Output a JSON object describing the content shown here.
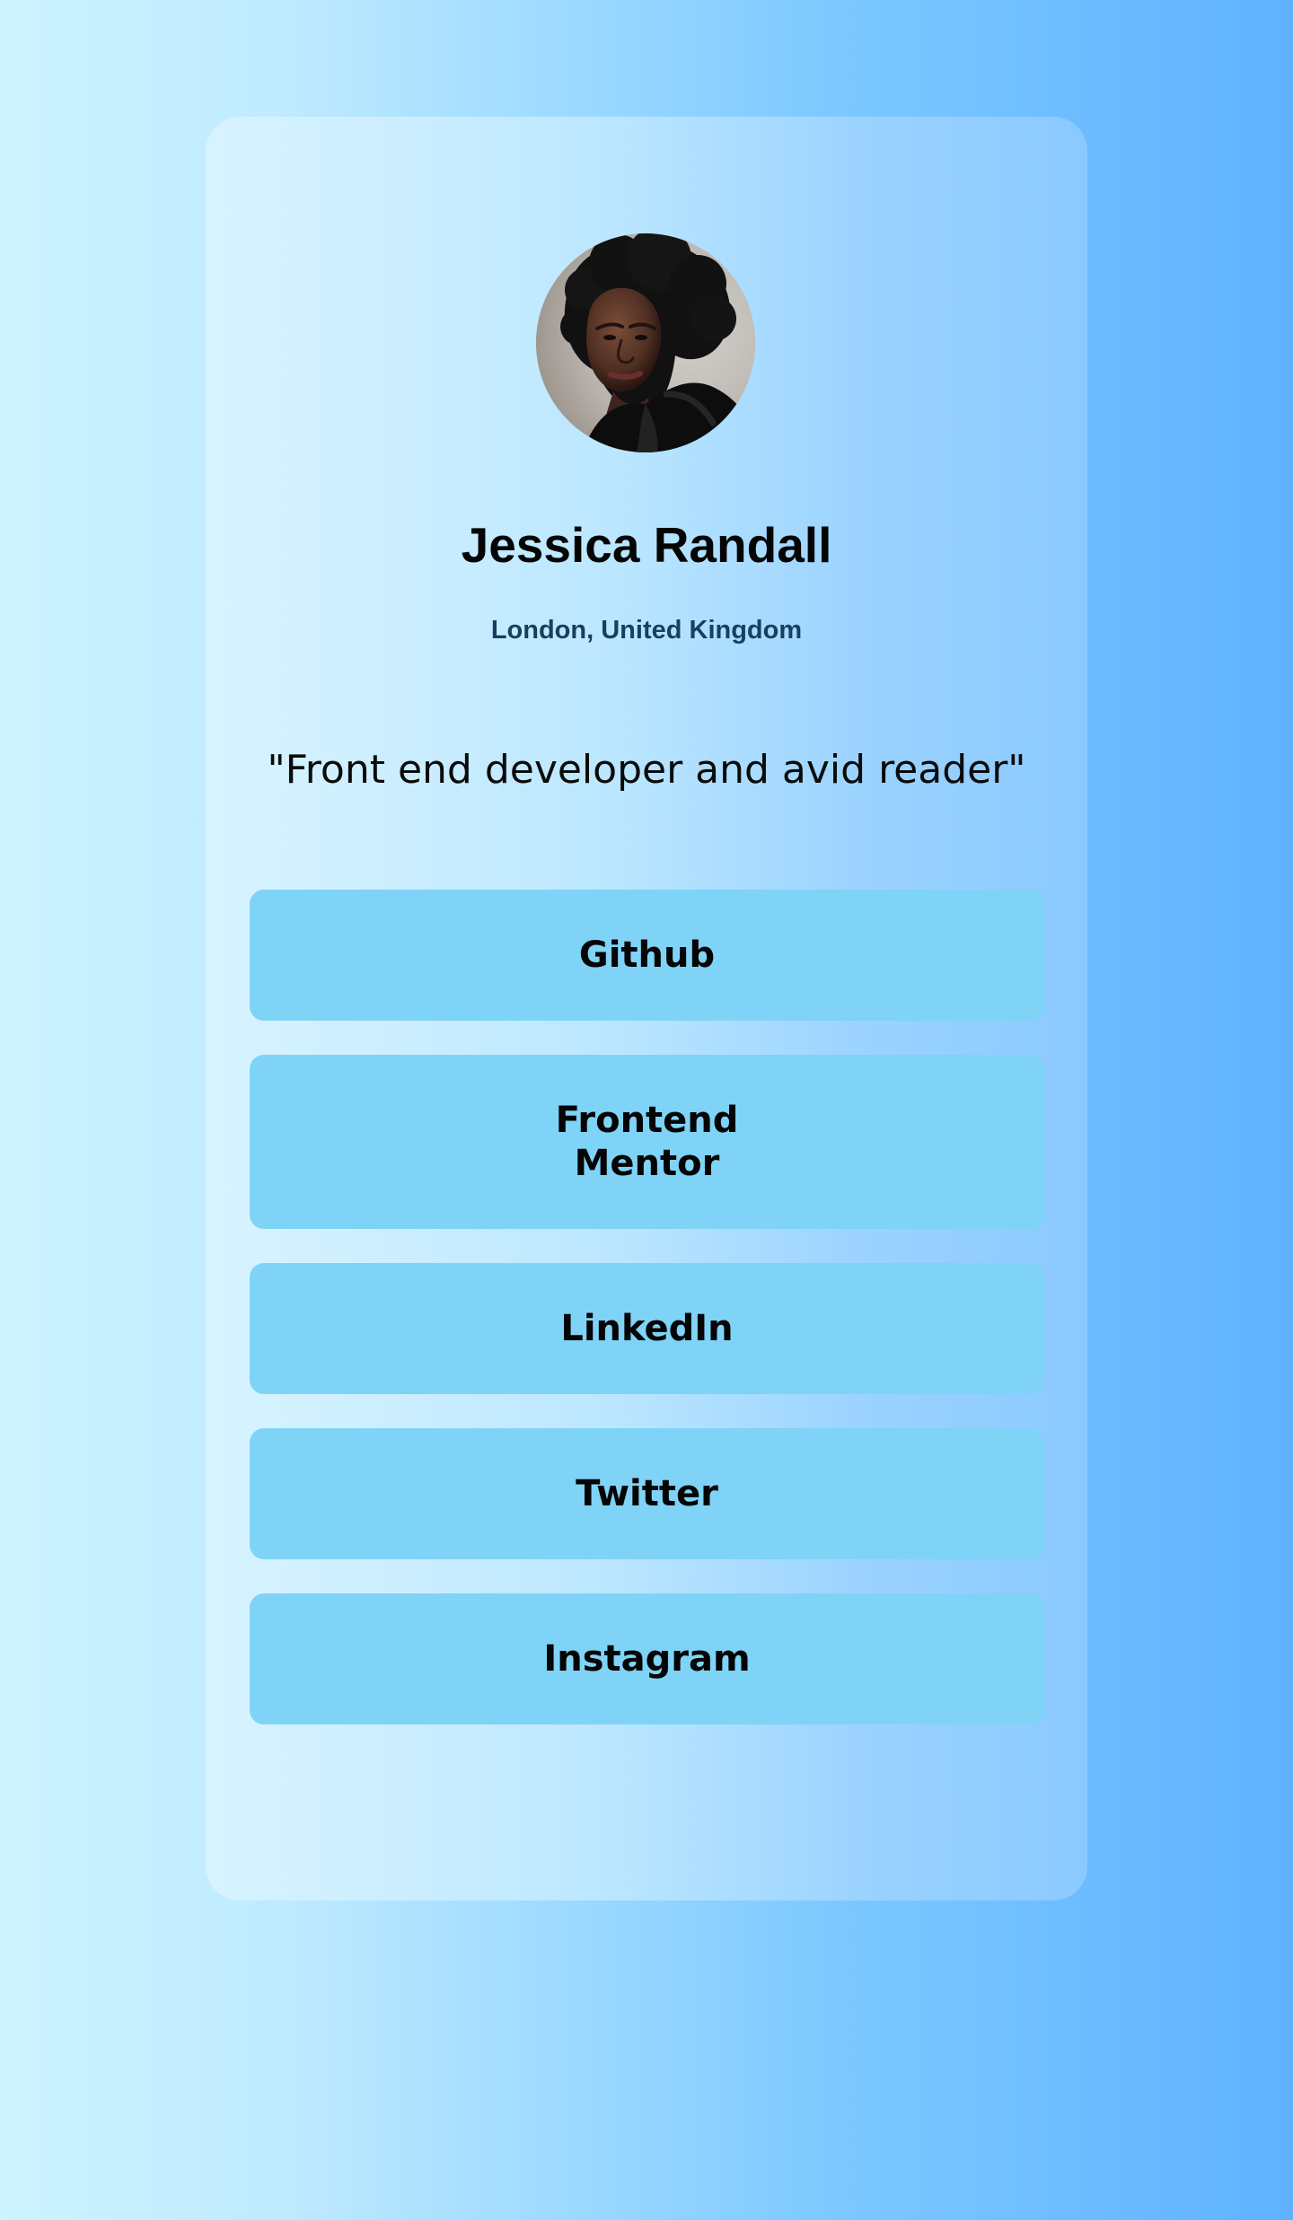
{
  "profile": {
    "avatar_alt": "Jessica Randall avatar",
    "name": "Jessica Randall",
    "location": "London, United Kingdom",
    "bio": "\"Front end developer and avid reader\""
  },
  "links": [
    {
      "label": "Github"
    },
    {
      "label": "Frontend Mentor"
    },
    {
      "label": "LinkedIn"
    },
    {
      "label": "Twitter"
    },
    {
      "label": "Instagram"
    }
  ],
  "colors": {
    "page_gradient_start": "#cdf4ff",
    "page_gradient_end": "#5fb2ff",
    "button_background": "#7fd3f7",
    "location_text": "#173f5f"
  }
}
